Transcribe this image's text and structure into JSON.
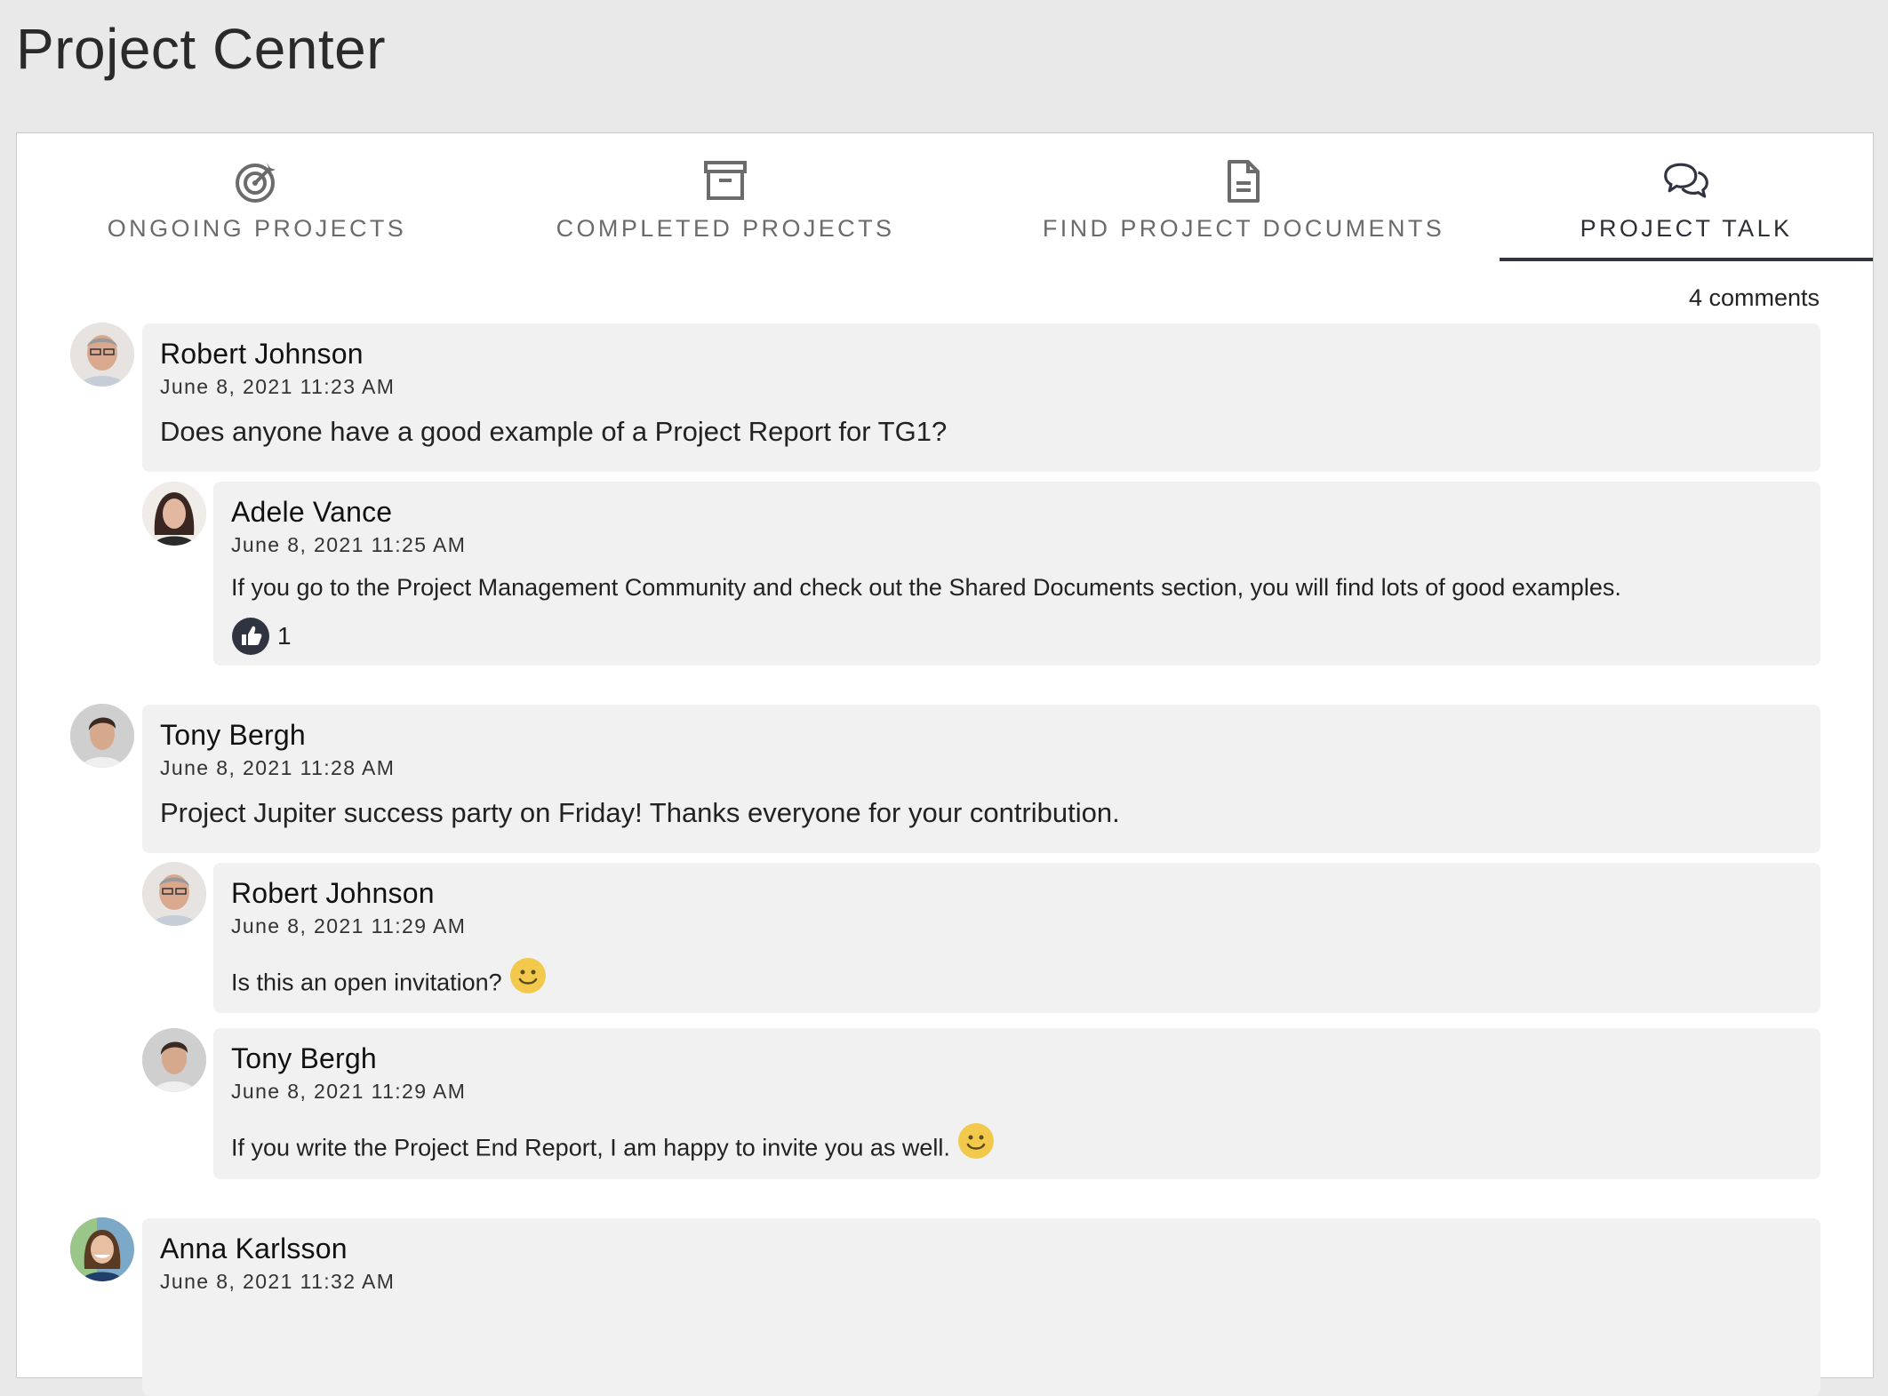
{
  "page": {
    "title": "Project Center"
  },
  "tabs": [
    {
      "label": "ONGOING PROJECTS",
      "icon": "target-icon",
      "active": false
    },
    {
      "label": "COMPLETED PROJECTS",
      "icon": "archive-box-icon",
      "active": false
    },
    {
      "label": "FIND PROJECT DOCUMENTS",
      "icon": "document-icon",
      "active": false
    },
    {
      "label": "PROJECT TALK",
      "icon": "chat-bubbles-icon",
      "active": true
    }
  ],
  "comments_count": "4 comments",
  "threads": [
    {
      "author": "Robert Johnson",
      "time": "June 8, 2021 11:23 AM",
      "text": "Does anyone have a good example of a Project Report for TG1?",
      "replies": [
        {
          "author": "Adele Vance",
          "time": "June 8, 2021 11:25 AM",
          "text": "If you go to the Project Management Community and check out the Shared Documents section, you will find lots of good examples.",
          "likes": "1"
        }
      ]
    },
    {
      "author": "Tony Bergh",
      "time": "June 8, 2021 11:28 AM",
      "text": "Project Jupiter success party on Friday! Thanks everyone for your contribution.",
      "replies": [
        {
          "author": "Robert Johnson",
          "time": "June 8, 2021 11:29 AM",
          "text": "Is this an open invitation?"
        },
        {
          "author": "Tony Bergh",
          "time": "June 8, 2021 11:29 AM",
          "text": "If you write the Project End Report, I am happy to invite you as well."
        }
      ]
    },
    {
      "author": "Anna Karlsson",
      "time": "June 8, 2021 11:32 AM"
    }
  ],
  "colors": {
    "active_tab_underline": "#2f3440",
    "comment_bg": "#f1f1f1",
    "page_bg": "#e9e9e9"
  }
}
